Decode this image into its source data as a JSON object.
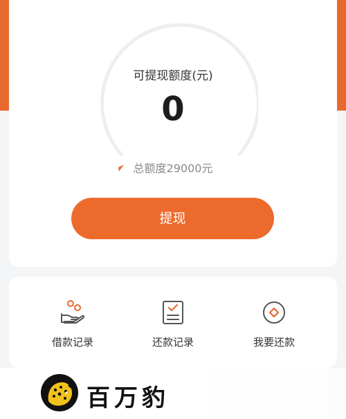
{
  "theme": {
    "accent": "#e8692f",
    "button": "#ec6a2c",
    "card_bg": "#ffffff",
    "page_bg": "#f4f5f7"
  },
  "balance": {
    "title": "可提现额度(元)",
    "amount": "0",
    "total": "总额度29000元"
  },
  "withdraw_button": {
    "label": "提现"
  },
  "actions": [
    {
      "label": "借款记录",
      "icon": "hand-coins-icon"
    },
    {
      "label": "还款记录",
      "icon": "checked-document-icon"
    },
    {
      "label": "我要还款",
      "icon": "repay-diamond-icon"
    }
  ],
  "watermark": {
    "name": "百万豹",
    "icon": "leopard-logo-icon"
  }
}
